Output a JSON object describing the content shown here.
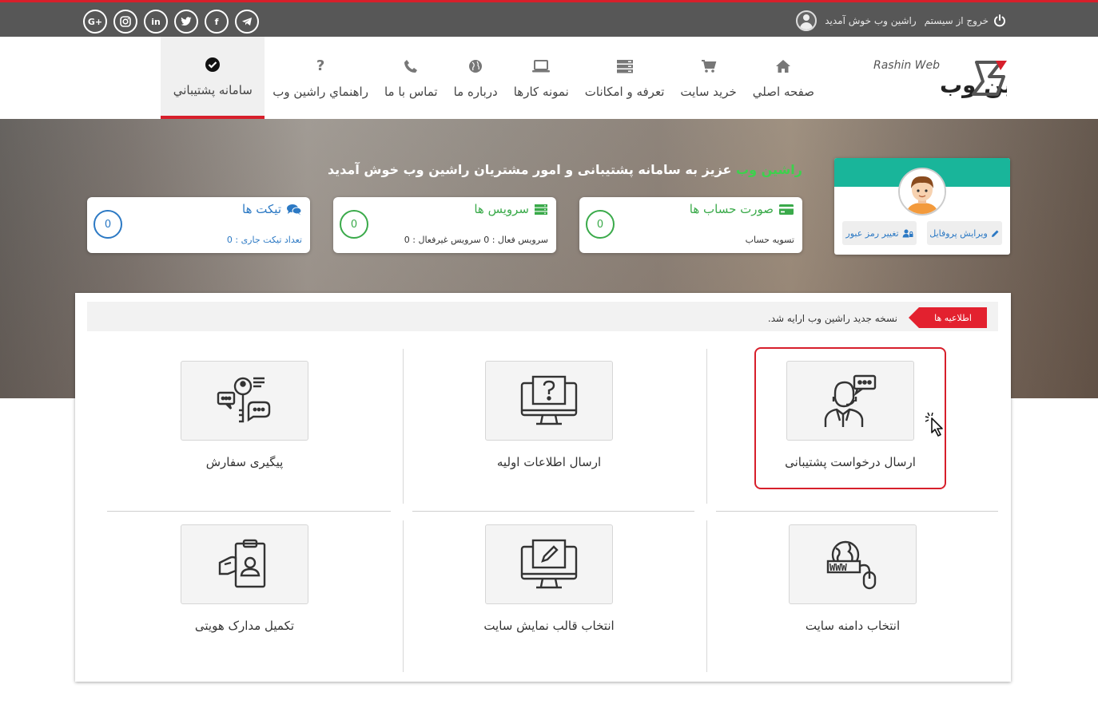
{
  "topbar": {
    "welcome": "راشين وب خوش آمديد",
    "logout": "خروج از سیستم",
    "socials": [
      "G+",
      "instagram",
      "in",
      "twitter",
      "f",
      "telegram"
    ]
  },
  "logo": {
    "latin": "Rashin Web",
    "persian": "راشین وب"
  },
  "nav": {
    "items": [
      {
        "label": "صفحه اصلي",
        "icon": "home-icon"
      },
      {
        "label": "خريد سايت",
        "icon": "cart-icon"
      },
      {
        "label": "تعرفه و امكانات",
        "icon": "server-icon"
      },
      {
        "label": "نمونه كارها",
        "icon": "laptop-icon"
      },
      {
        "label": "درباره ما",
        "icon": "globe-icon"
      },
      {
        "label": "تماس با ما",
        "icon": "phone-icon"
      },
      {
        "label": "راهنماي راشين وب",
        "icon": "question-icon"
      },
      {
        "label": "سامانه پشتيباني",
        "icon": "check-circle-icon",
        "active": true
      }
    ]
  },
  "hero": {
    "welcome_name": "راشین وب",
    "welcome_text": " عزیز به سامانه پشتیبانی و امور مشتریان راشین وب خوش آمدید"
  },
  "profile": {
    "edit_profile": "ویرایش پروفایل",
    "change_password": "تغییر رمز عبور"
  },
  "stats": {
    "invoices": {
      "title": "صورت حساب ها",
      "sub": "تسویه حساب",
      "count": "0"
    },
    "services": {
      "title": "سرویس ها",
      "sub": "سرویس فعال : 0      سرویس غیرفعال : 0",
      "count": "0"
    },
    "tickets": {
      "title": "تیکت ها",
      "sub": "تعداد تیکت جاری : 0",
      "count": "0"
    }
  },
  "notice": {
    "badge": "اطلاعیه ها",
    "text": "نسخه جدید راشین وب ارایه شد."
  },
  "tiles": [
    {
      "label": "ارسال درخواست پشتیبانی",
      "icon": "support-agent-icon",
      "selected": true
    },
    {
      "label": "ارسال اطلاعات اولیه",
      "icon": "monitor-question-icon"
    },
    {
      "label": "پیگیری سفارش",
      "icon": "key-chat-icon"
    },
    {
      "label": "انتخاب دامنه سایت",
      "icon": "globe-www-icon"
    },
    {
      "label": "انتخاب قالب نمایش سایت",
      "icon": "monitor-pen-icon"
    },
    {
      "label": "تکمیل مدارک هویتی",
      "icon": "id-card-icon"
    }
  ],
  "colors": {
    "accent_red": "#d71f2b",
    "teal": "#19b59a",
    "green": "#3aaa4a",
    "blue": "#2c79c4",
    "topbar": "#575757"
  }
}
